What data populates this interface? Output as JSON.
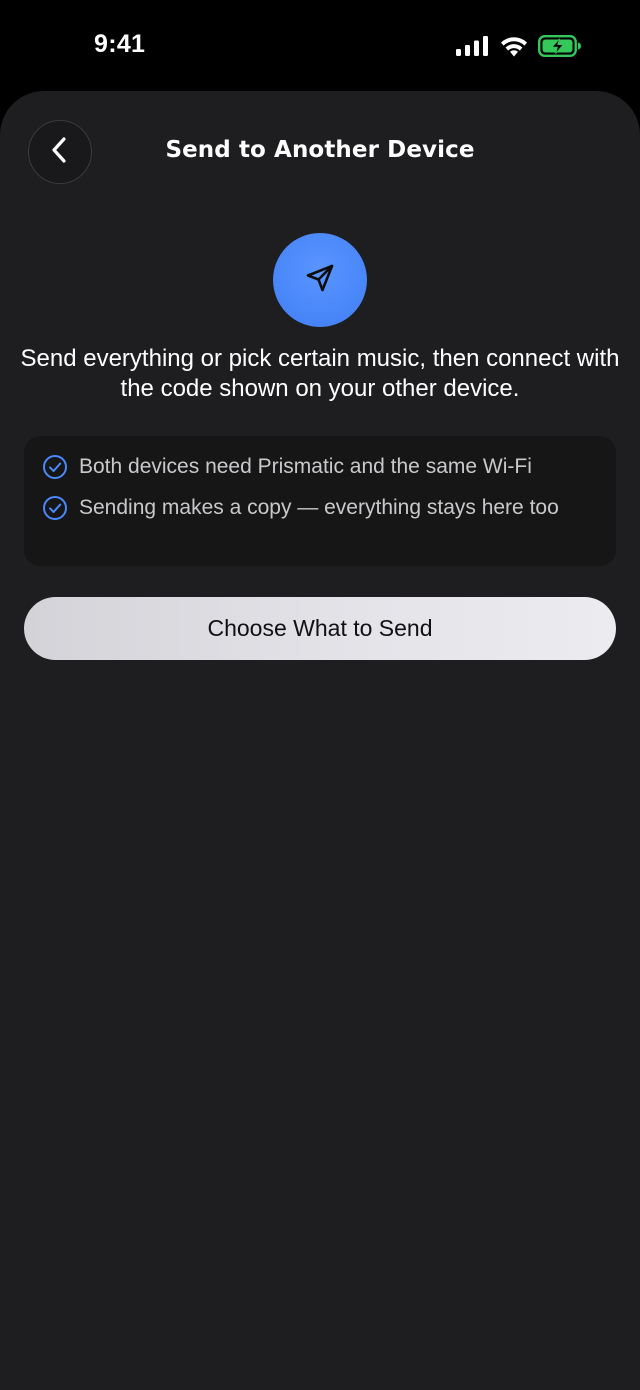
{
  "status_bar": {
    "time": "9:41",
    "icons": [
      "signal-icon",
      "wifi-icon",
      "battery-charging-icon"
    ],
    "battery_color": "#34c759"
  },
  "header": {
    "back_icon": "chevron-left-icon",
    "title": "Send to Another Device"
  },
  "hero": {
    "icon": "paper-plane-icon",
    "color": "#4a88fb"
  },
  "description": "Send everything or pick certain music, then connect with the code shown on your other device.",
  "info": {
    "check_icon": "check-circle-icon",
    "accent": "#4a88fb",
    "items": [
      "Both devices need Prismatic and the same Wi-Fi",
      "Sending makes a copy — everything stays here too"
    ]
  },
  "primary_button": {
    "label": "Choose What to Send"
  }
}
